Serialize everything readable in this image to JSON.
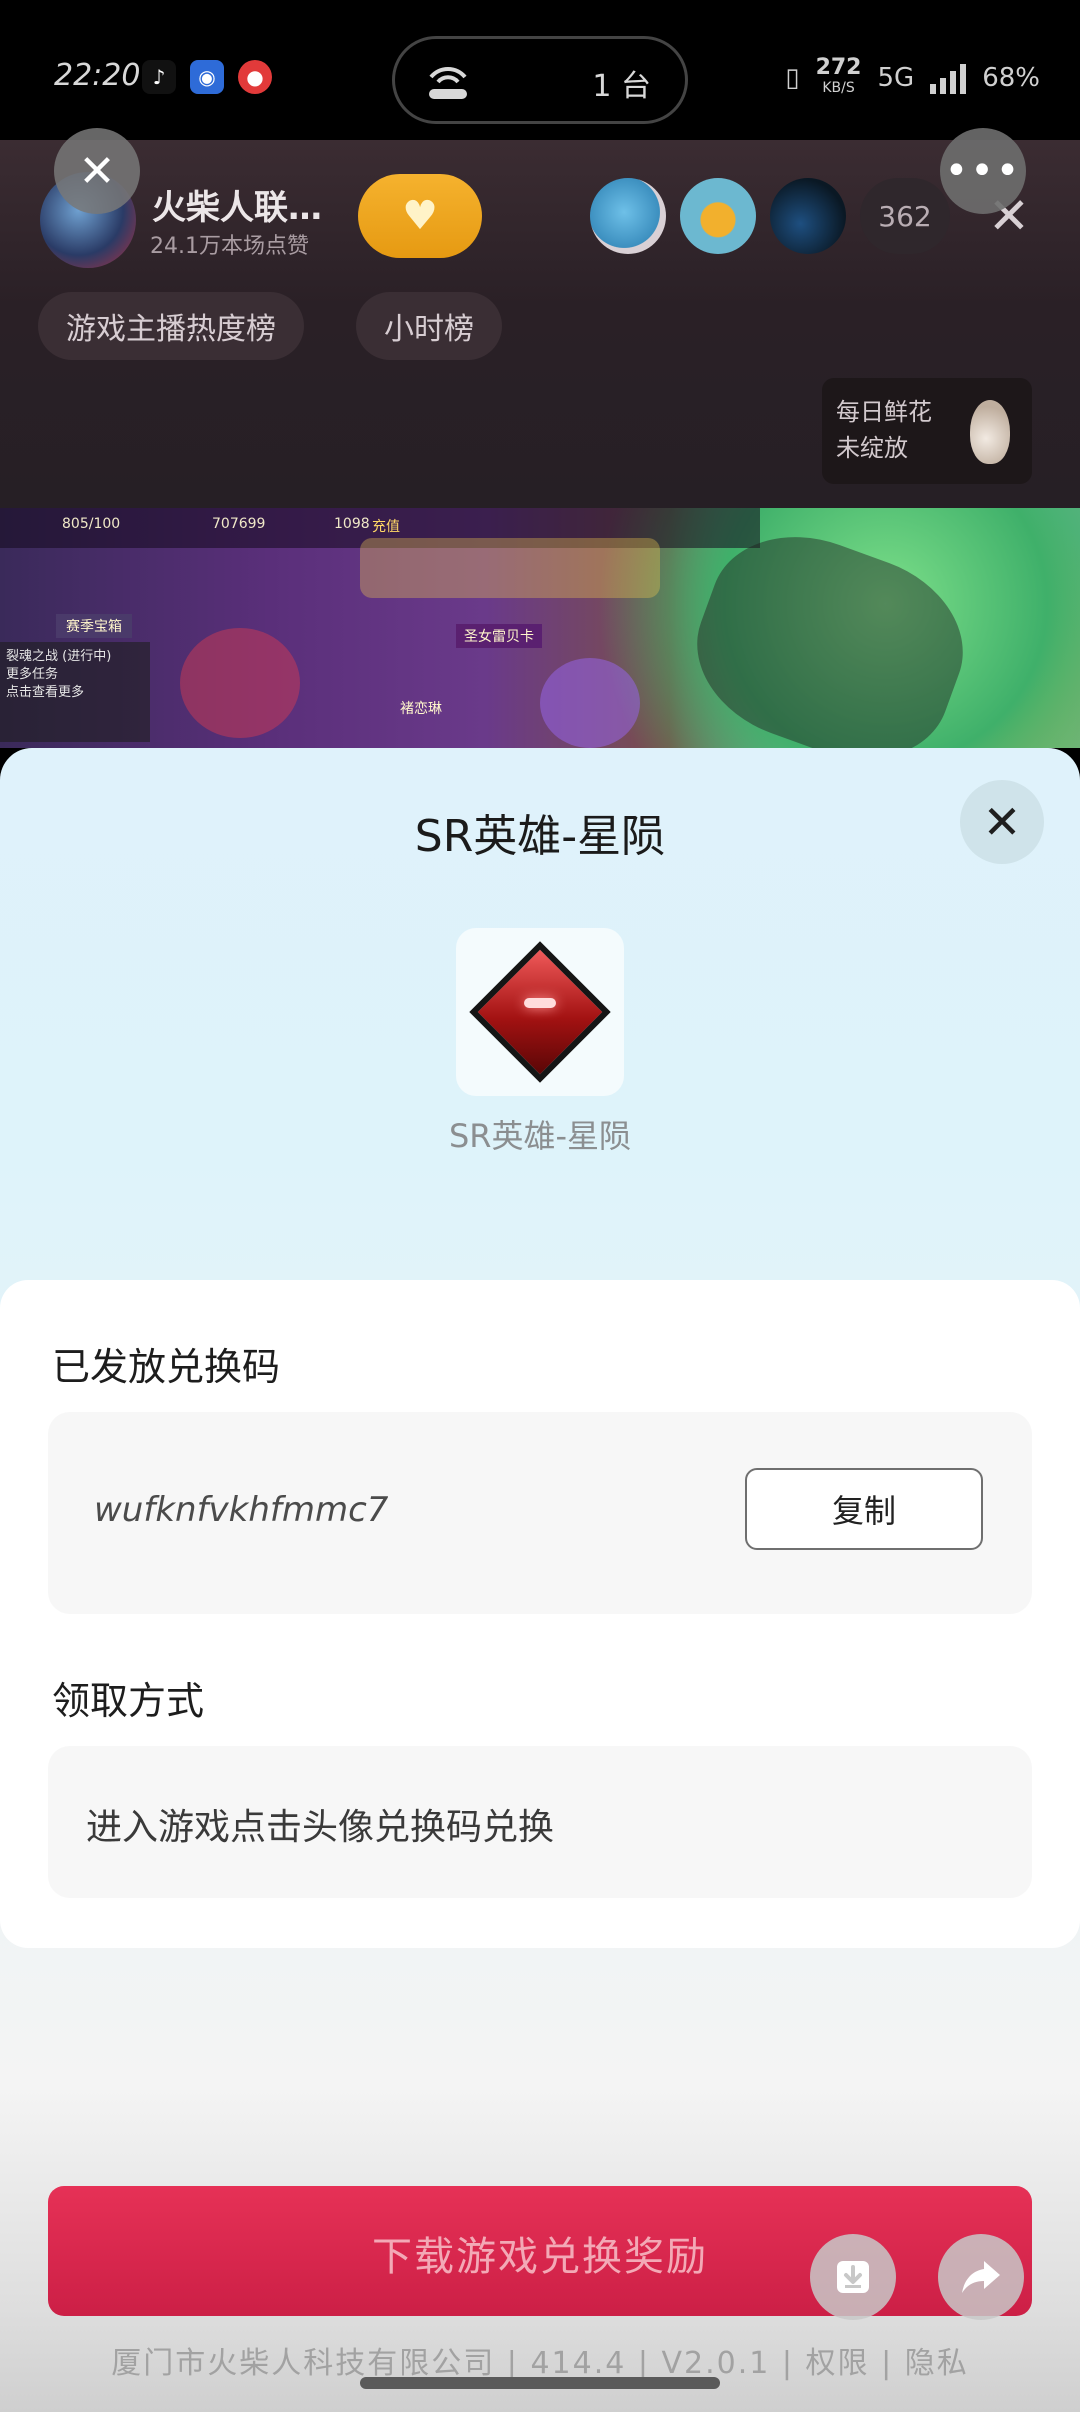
{
  "status_bar": {
    "time": "22:20",
    "island_count": "1 台",
    "net_speed_value": "272",
    "net_speed_unit": "KB/S",
    "network": "5G",
    "battery": "68%"
  },
  "live": {
    "host_name": "火柴人联…",
    "host_likes": "24.1万本场点赞",
    "viewer_count": "362",
    "tags": [
      "游戏主播热度榜",
      "小时榜"
    ],
    "flower_text": "每日鲜花 未绽放"
  },
  "game_hud": {
    "hp": "805/100",
    "gold": "707699",
    "gems": "1098",
    "topup": "充值",
    "event": "赛季宝箱",
    "task1": "裂魂之战",
    "task1_status": "(进行中)",
    "task2": "更多任务",
    "task2_hint": "点击查看更多",
    "card": "圣女雷贝卡",
    "npc": "褚恋琳"
  },
  "sheet": {
    "title": "SR英雄-星陨",
    "item_name": "SR英雄-星陨",
    "code_section_label": "已发放兑换码",
    "code": "wufknfvkhfmmc7",
    "copy_label": "复制",
    "method_section_label": "领取方式",
    "method_text": "进入游戏点击头像兑换码兑换",
    "download_label": "下载游戏兑换奖励",
    "footer": "厦门市火柴人科技有限公司 | 414.4 | V2.0.1 | 权限 | 隐私"
  },
  "colors": {
    "accent": "#d8254c",
    "sheet_bg": "#dff2fb",
    "heart_btn": "#f0a820"
  },
  "icons": {
    "overlay_close": "close-icon",
    "overlay_more": "more-icon",
    "sheet_close": "close-icon",
    "fab_download": "download-icon",
    "fab_share": "share-icon"
  }
}
